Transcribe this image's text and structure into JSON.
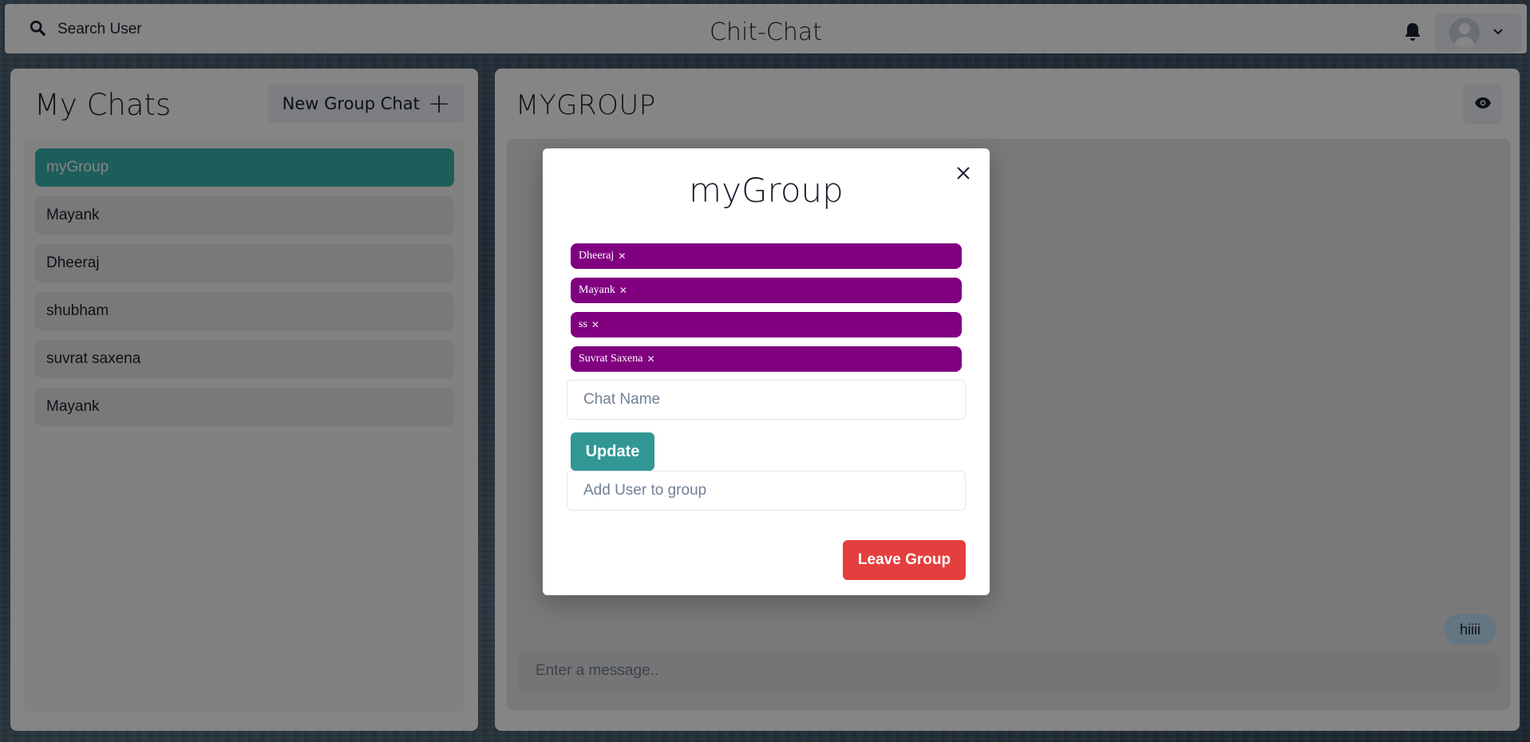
{
  "header": {
    "search_label": "Search User",
    "app_title": "Chit-Chat",
    "icons": {
      "search": "search-icon",
      "bell": "bell-icon",
      "profile": "user-avatar",
      "chevron": "chevron-down-icon"
    }
  },
  "sidebar": {
    "title": "My Chats",
    "new_group_label": "New Group Chat",
    "chats": [
      {
        "label": "myGroup",
        "active": true
      },
      {
        "label": "Mayank"
      },
      {
        "label": "Dheeraj"
      },
      {
        "label": "shubham"
      },
      {
        "label": "suvrat saxena"
      },
      {
        "label": "Mayank"
      }
    ]
  },
  "chat": {
    "title": "MYGROUP",
    "messages": [
      {
        "text": "hiiii"
      }
    ],
    "input_placeholder": "Enter a message.."
  },
  "modal": {
    "title": "myGroup",
    "members": [
      {
        "name": "Dheeraj"
      },
      {
        "name": "Mayank "
      },
      {
        "name": "ss"
      },
      {
        "name": "Suvrat Saxena"
      }
    ],
    "chat_name_placeholder": "Chat Name",
    "update_label": "Update",
    "add_user_placeholder": "Add User to group",
    "leave_label": "Leave Group"
  },
  "colors": {
    "accent": "#38b2ac",
    "badge": "#800080",
    "danger": "#e53e3e",
    "update": "#319795"
  }
}
